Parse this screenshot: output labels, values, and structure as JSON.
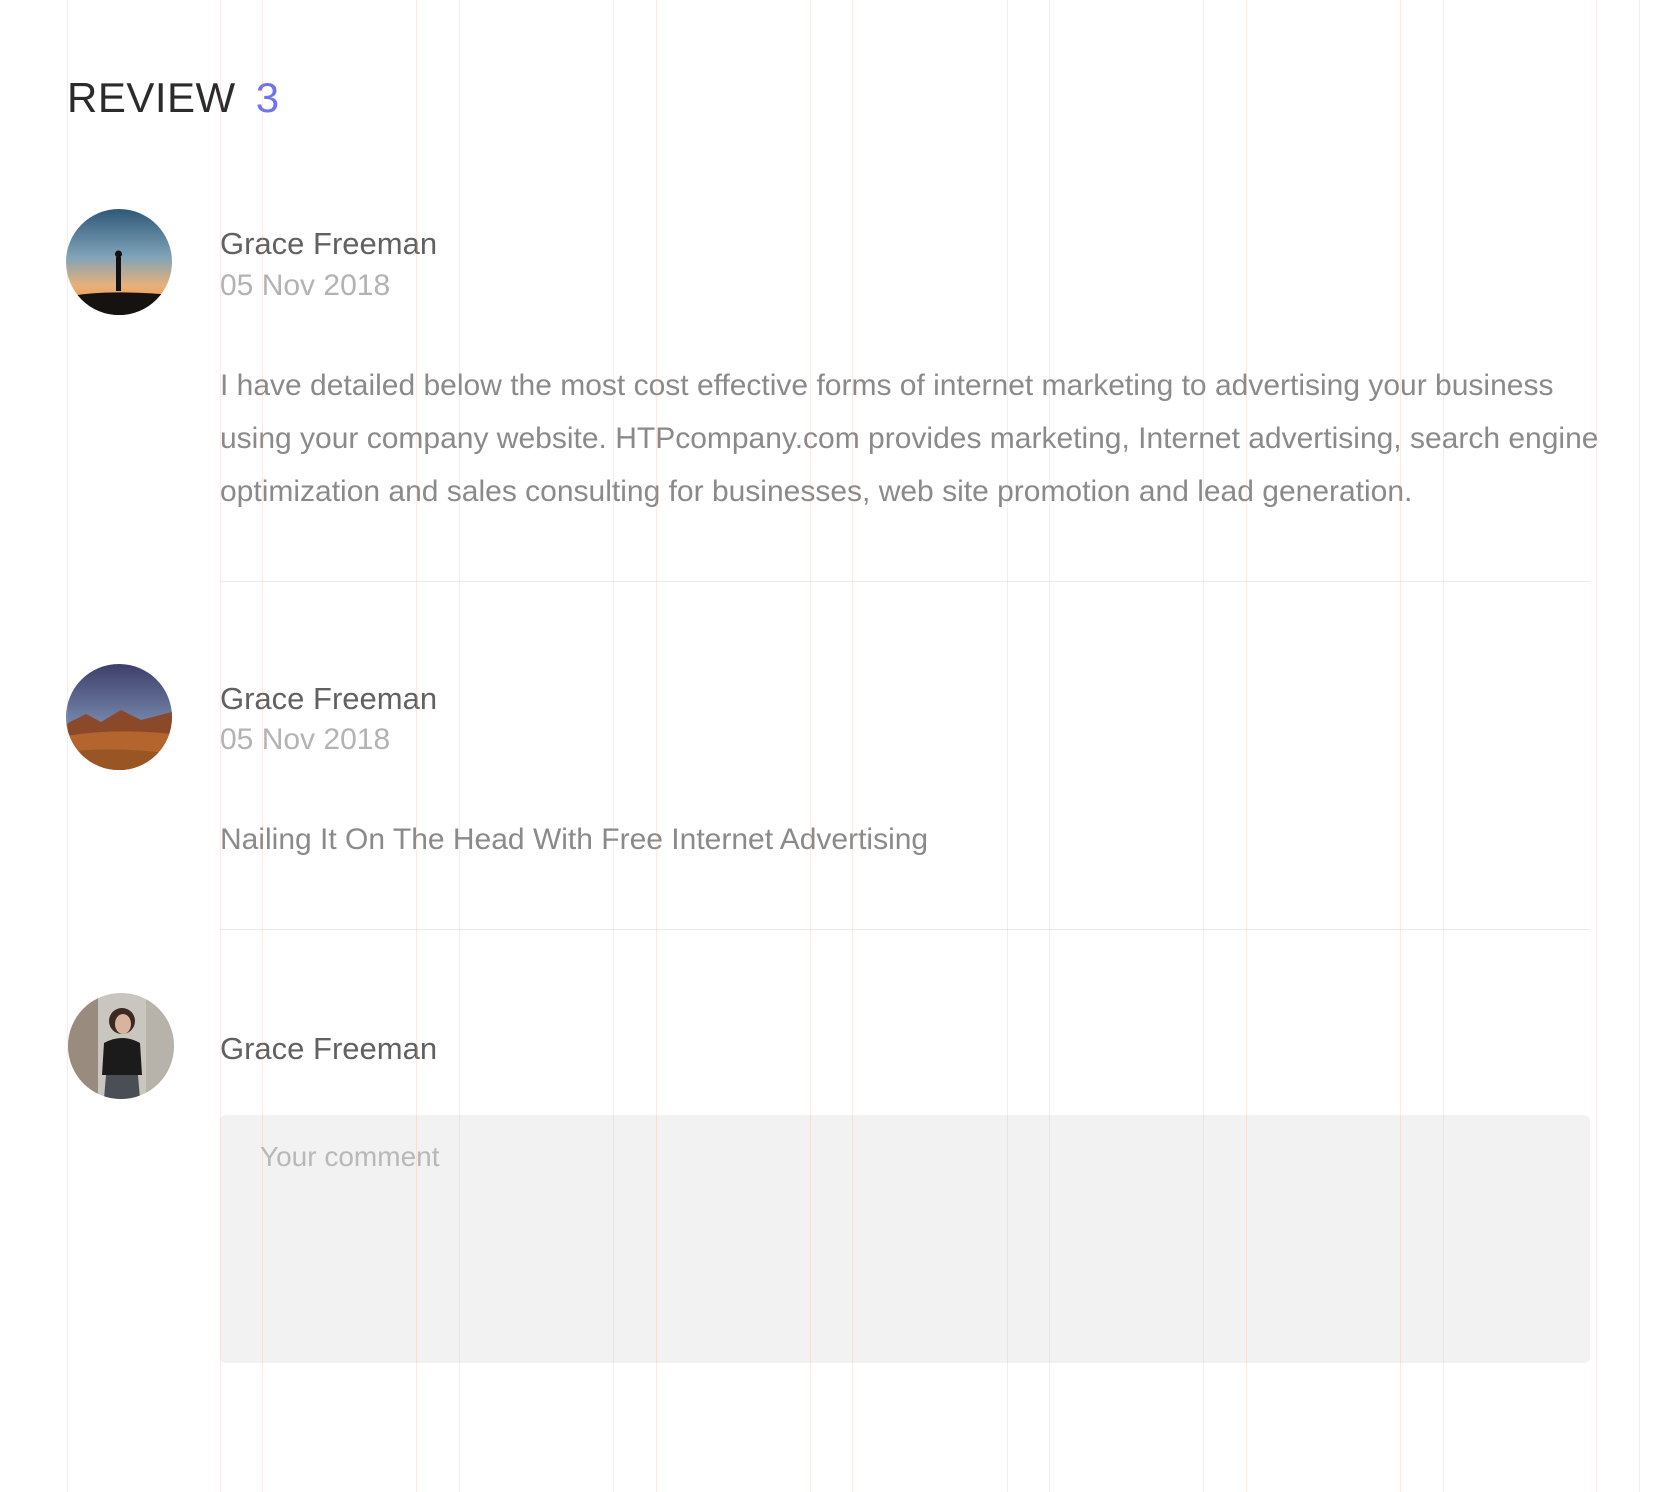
{
  "reviews_section": {
    "heading": "REVIEW",
    "count": "3"
  },
  "reviews": [
    {
      "author": "Grace Freeman",
      "date": "05 Nov 2018",
      "text": "I have detailed below the most cost effective forms of internet marketing to advertising your business using your company website. HTPcompany.com provides marketing, Internet advertising, search engine optimization and sales consulting for businesses, web site promotion and lead generation."
    },
    {
      "author": "Grace Freeman",
      "date": "05 Nov 2018",
      "text": "Nailing It On The Head With Free Internet Advertising"
    }
  ],
  "comment_form": {
    "author": "Grace Freeman",
    "placeholder": "Your comment"
  },
  "colors": {
    "accent": "#6f73f0",
    "heading": "#2b2b2b",
    "name": "#616161",
    "date": "#b3b3b3",
    "body_text": "#8a8a8a",
    "input_bg": "#f2f2f2"
  }
}
